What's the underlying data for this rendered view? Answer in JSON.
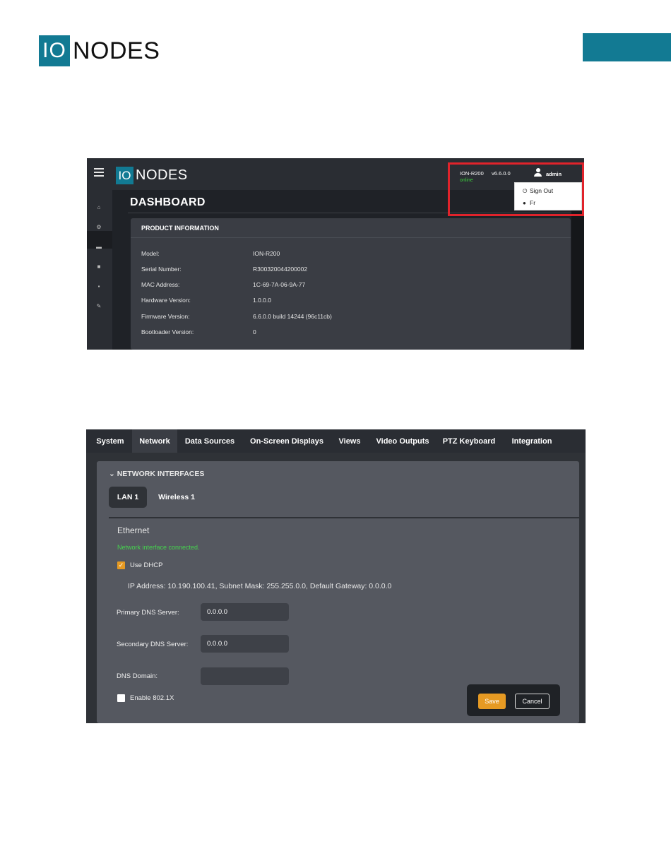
{
  "doc_header": {
    "logo_io": "IO",
    "logo_nodes": "NODES"
  },
  "dashboard": {
    "logo_io": "IO",
    "logo_nodes": "NODES",
    "title": "DASHBOARD",
    "device_model": "ION-R200",
    "version": "v6.6.0.0",
    "status": "online",
    "user": "admin",
    "user_menu": [
      {
        "icon": "power-icon",
        "label": "Sign Out"
      },
      {
        "icon": "speech-bubble-icon",
        "label": "Fr"
      }
    ],
    "sidebar_icons": [
      "home-icon",
      "gear-icon",
      "folder-icon",
      "camera-icon",
      "lock-icon",
      "wrench-icon"
    ],
    "panel_title": "PRODUCT INFORMATION",
    "rows": [
      {
        "label": "Model:",
        "value": "ION-R200"
      },
      {
        "label": "Serial Number:",
        "value": "R300320044200002"
      },
      {
        "label": "MAC Address:",
        "value": "1C-69-7A-06-9A-77"
      },
      {
        "label": "Hardware Version:",
        "value": "1.0.0.0"
      },
      {
        "label": "Firmware Version:",
        "value": "6.6.0.0 build 14244 (96c11cb)"
      },
      {
        "label": "Bootloader Version:",
        "value": "0"
      }
    ]
  },
  "network": {
    "tabs": [
      "System",
      "Network",
      "Data Sources",
      "On-Screen Displays",
      "Views",
      "Video Outputs",
      "PTZ Keyboard",
      "Integration"
    ],
    "active_tab": "Network",
    "section_title": "NETWORK INTERFACES",
    "subtabs": [
      "LAN 1",
      "Wireless 1"
    ],
    "heading": "Ethernet",
    "connection_status": "Network interface connected.",
    "use_dhcp": {
      "label": "Use DHCP",
      "checked": true
    },
    "ip_info": "IP Address: 10.190.100.41, Subnet Mask: 255.255.0.0, Default Gateway: 0.0.0.0",
    "primary_dns": {
      "label": "Primary DNS Server:",
      "value": "0.0.0.0"
    },
    "secondary_dns": {
      "label": "Secondary DNS Server:",
      "value": "0.0.0.0"
    },
    "dns_domain": {
      "label": "DNS Domain:",
      "value": ""
    },
    "enable_8021x": {
      "label": "Enable 802.1X",
      "checked": false
    },
    "save_label": "Save",
    "cancel_label": "Cancel"
  },
  "colors": {
    "brand": "#127a93",
    "accent": "#e69a23",
    "online": "#3ccf3c",
    "highlight": "#e0232b"
  }
}
